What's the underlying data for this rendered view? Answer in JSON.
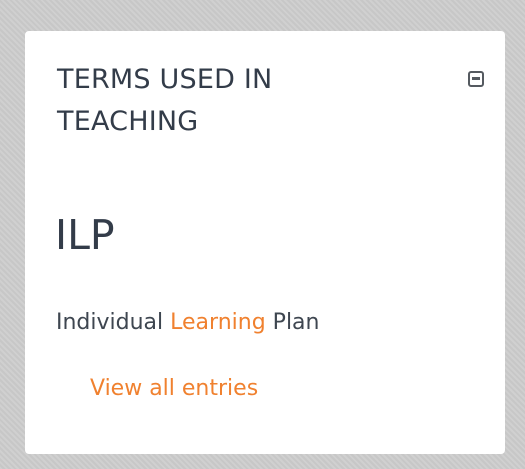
{
  "block": {
    "title": "TERMS USED IN TEACHING",
    "collapse_icon": "collapse-icon",
    "entry": {
      "term": "ILP",
      "definition_parts": [
        "Individual",
        "Learning",
        "Plan"
      ]
    },
    "view_all_label": "View all entries"
  },
  "colors": {
    "accent": "#f0812f",
    "text": "#333c49",
    "background": "#cdcdcd",
    "card": "#ffffff"
  }
}
